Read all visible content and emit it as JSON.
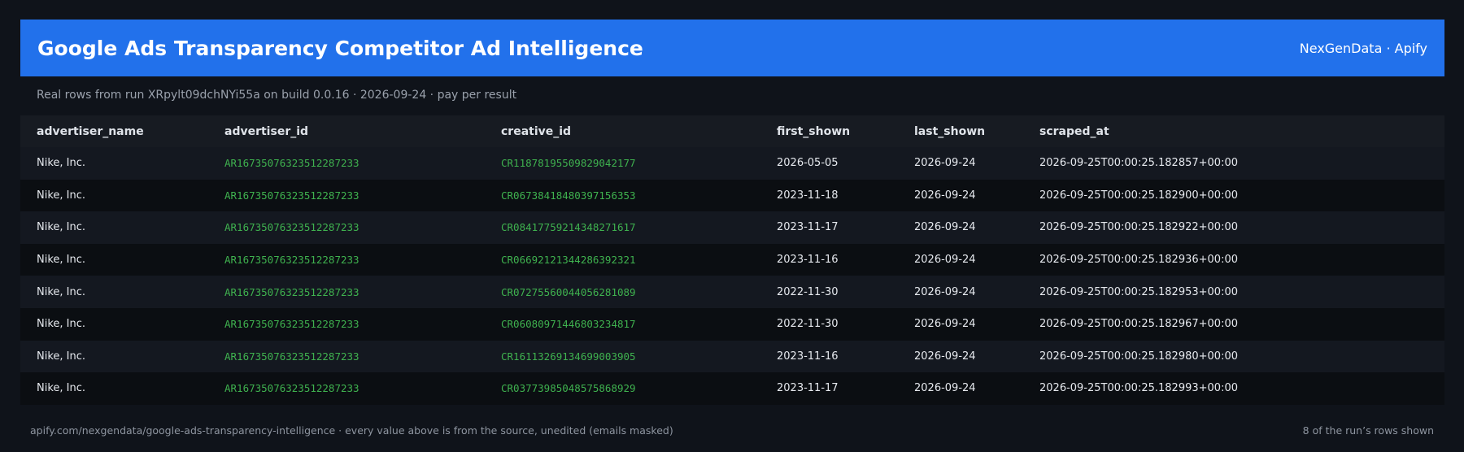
{
  "header": {
    "title": "Google Ads Transparency Competitor Ad Intelligence",
    "brand": "NexGenData · Apify"
  },
  "subline": "Real rows from run XRpylt09dchNYi55a on build 0.0.16 · 2026-09-24 · pay per result",
  "table": {
    "columns": [
      "advertiser_name",
      "advertiser_id",
      "creative_id",
      "first_shown",
      "last_shown",
      "scraped_at"
    ],
    "rows": [
      [
        "Nike, Inc.",
        "AR16735076323512287233",
        "CR11878195509829042177",
        "2026-05-05",
        "2026-09-24",
        "2026-09-25T00:00:25.182857+00:00"
      ],
      [
        "Nike, Inc.",
        "AR16735076323512287233",
        "CR06738418480397156353",
        "2023-11-18",
        "2026-09-24",
        "2026-09-25T00:00:25.182900+00:00"
      ],
      [
        "Nike, Inc.",
        "AR16735076323512287233",
        "CR08417759214348271617",
        "2023-11-17",
        "2026-09-24",
        "2026-09-25T00:00:25.182922+00:00"
      ],
      [
        "Nike, Inc.",
        "AR16735076323512287233",
        "CR06692121344286392321",
        "2023-11-16",
        "2026-09-24",
        "2026-09-25T00:00:25.182936+00:00"
      ],
      [
        "Nike, Inc.",
        "AR16735076323512287233",
        "CR07275560044056281089",
        "2022-11-30",
        "2026-09-24",
        "2026-09-25T00:00:25.182953+00:00"
      ],
      [
        "Nike, Inc.",
        "AR16735076323512287233",
        "CR06080971446803234817",
        "2022-11-30",
        "2026-09-24",
        "2026-09-25T00:00:25.182967+00:00"
      ],
      [
        "Nike, Inc.",
        "AR16735076323512287233",
        "CR16113269134699003905",
        "2023-11-16",
        "2026-09-24",
        "2026-09-25T00:00:25.182980+00:00"
      ],
      [
        "Nike, Inc.",
        "AR16735076323512287233",
        "CR03773985048575868929",
        "2023-11-17",
        "2026-09-24",
        "2026-09-25T00:00:25.182993+00:00"
      ]
    ]
  },
  "footer": {
    "left": "apify.com/nexgendata/google-ads-transparency-intelligence  ·  every value above is from the source, unedited (emails masked)",
    "right": "8 of the run’s rows shown"
  },
  "colors": {
    "header_bg": "#2271eb",
    "page_bg": "#0f131a",
    "id_text": "#3fb24f"
  }
}
